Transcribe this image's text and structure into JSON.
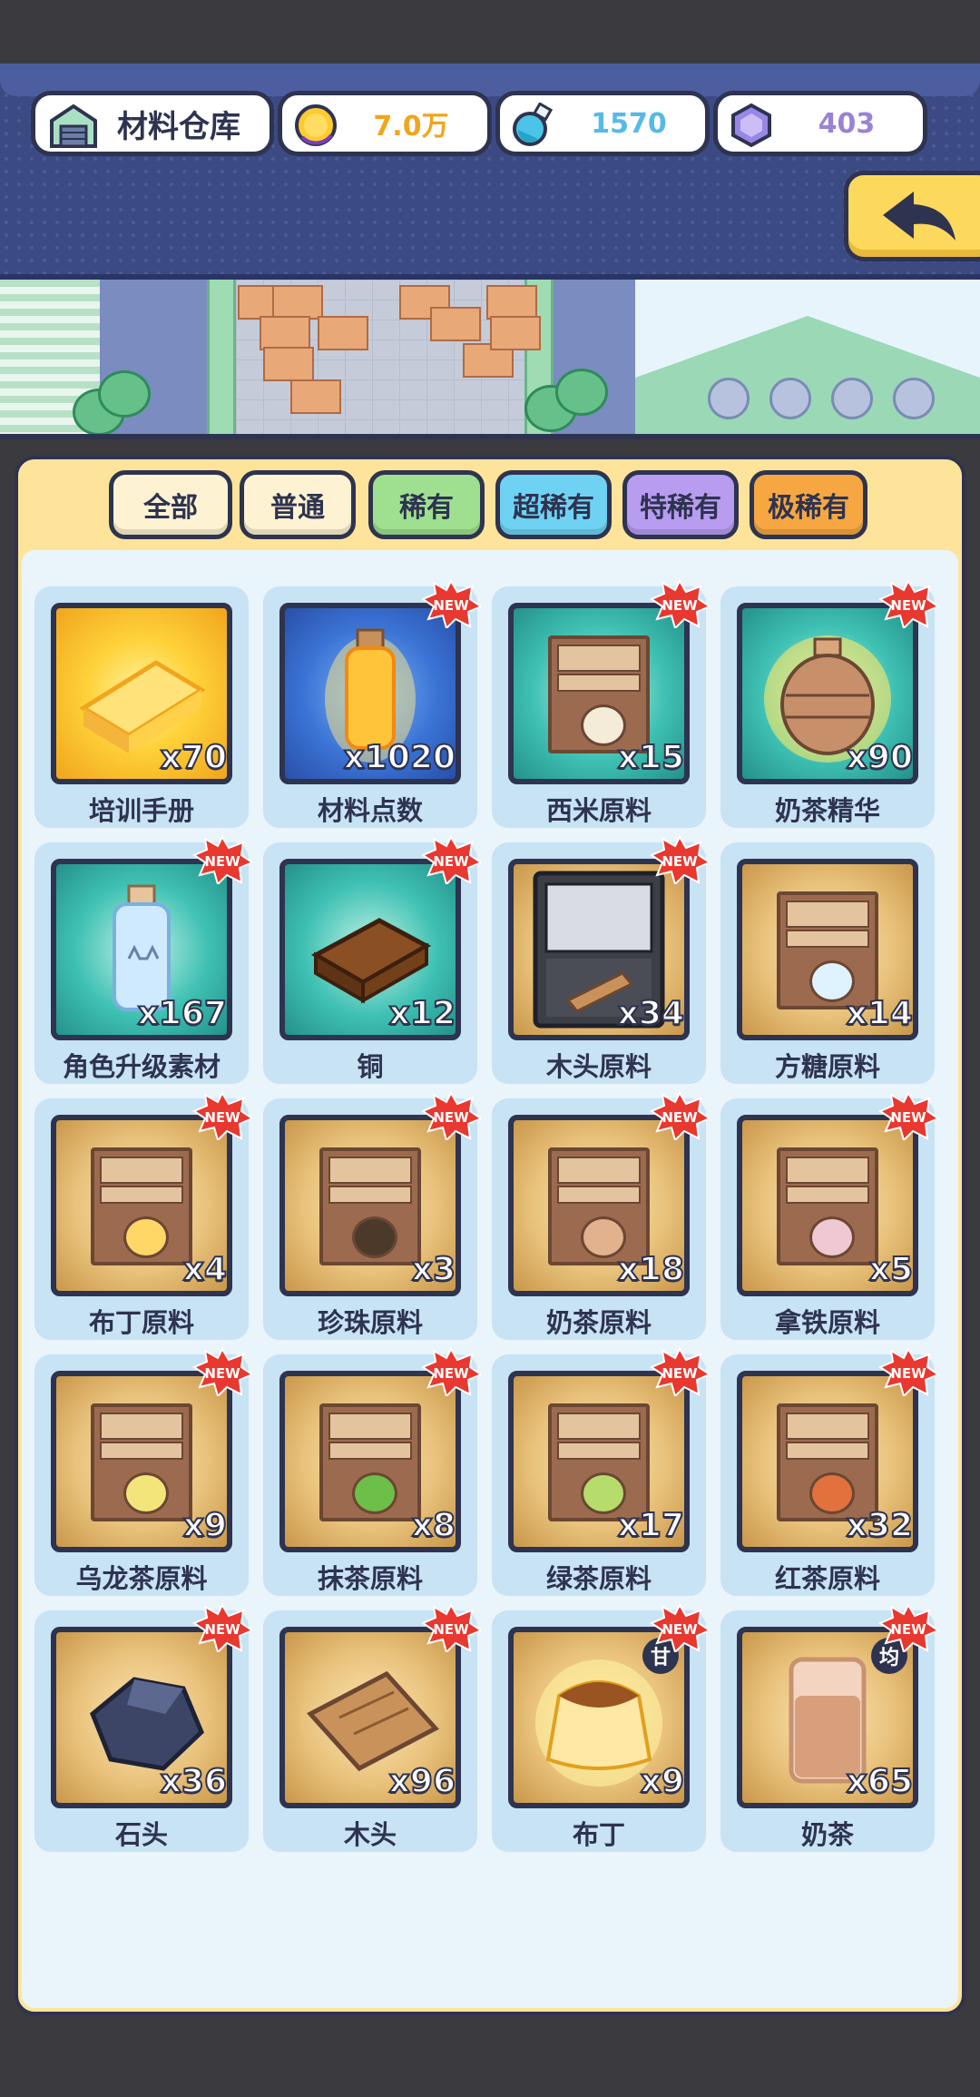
{
  "header": {
    "title": "材料仓库",
    "coins": "7.0万",
    "potions": "1570",
    "gems": "403",
    "colors": {
      "coins": "#f1a51c",
      "potions": "#56b9e6",
      "gems": "#9a82d6"
    }
  },
  "tabs": [
    {
      "label": "全部",
      "color": "#fdf3d2"
    },
    {
      "label": "普通",
      "color": "#fdf3d2"
    },
    {
      "label": "稀有",
      "color": "#9ee08f"
    },
    {
      "label": "超稀有",
      "color": "#6fd2f2"
    },
    {
      "label": "特稀有",
      "color": "#b79cf0"
    },
    {
      "label": "极稀有",
      "color": "#f6a741"
    }
  ],
  "items": [
    {
      "name": "培训手册",
      "qty": "x70",
      "bg": "yel",
      "icon": "book-icon",
      "new": false
    },
    {
      "name": "材料点数",
      "qty": "x1020",
      "bg": "blue",
      "icon": "glowing-bottle-icon",
      "new": true
    },
    {
      "name": "西米原料",
      "qty": "x15",
      "bg": "teal",
      "icon": "sago-box-icon",
      "new": true
    },
    {
      "name": "奶茶精华",
      "qty": "x90",
      "bg": "teal",
      "icon": "essence-jar-icon",
      "new": true
    },
    {
      "name": "角色升级素材",
      "qty": "x167",
      "bg": "teal",
      "icon": "cat-bottle-icon",
      "new": true
    },
    {
      "name": "铜",
      "qty": "x12",
      "bg": "teal",
      "icon": "copper-bar-icon",
      "new": true
    },
    {
      "name": "木头原料",
      "qty": "x34",
      "bg": "gold",
      "icon": "wood-crate-icon",
      "new": true
    },
    {
      "name": "方糖原料",
      "qty": "x14",
      "bg": "gold",
      "icon": "sugar-box-icon",
      "new": false
    },
    {
      "name": "布丁原料",
      "qty": "x4",
      "bg": "gold",
      "icon": "pudding-box-icon",
      "new": true
    },
    {
      "name": "珍珠原料",
      "qty": "x3",
      "bg": "gold",
      "icon": "pearl-box-icon",
      "new": true
    },
    {
      "name": "奶茶原料",
      "qty": "x18",
      "bg": "gold",
      "icon": "milk-tea-box-icon",
      "new": true
    },
    {
      "name": "拿铁原料",
      "qty": "x5",
      "bg": "gold",
      "icon": "latte-box-icon",
      "new": true
    },
    {
      "name": "乌龙茶原料",
      "qty": "x9",
      "bg": "gold",
      "icon": "oolong-box-icon",
      "new": true
    },
    {
      "name": "抹茶原料",
      "qty": "x8",
      "bg": "gold",
      "icon": "matcha-box-icon",
      "new": true
    },
    {
      "name": "绿茶原料",
      "qty": "x17",
      "bg": "gold",
      "icon": "green-tea-box-icon",
      "new": true
    },
    {
      "name": "红茶原料",
      "qty": "x32",
      "bg": "gold",
      "icon": "black-tea-box-icon",
      "new": true
    },
    {
      "name": "石头",
      "qty": "x36",
      "bg": "gold",
      "icon": "stone-icon",
      "new": true
    },
    {
      "name": "木头",
      "qty": "x96",
      "bg": "gold",
      "icon": "wood-plank-icon",
      "new": true
    },
    {
      "name": "布丁",
      "qty": "x9",
      "bg": "gold",
      "icon": "pudding-icon",
      "new": true,
      "tag": "甘"
    },
    {
      "name": "奶茶",
      "qty": "x65",
      "bg": "gold",
      "icon": "milk-tea-icon",
      "new": true,
      "tag": "均"
    }
  ],
  "new_badge_text": "NEW"
}
